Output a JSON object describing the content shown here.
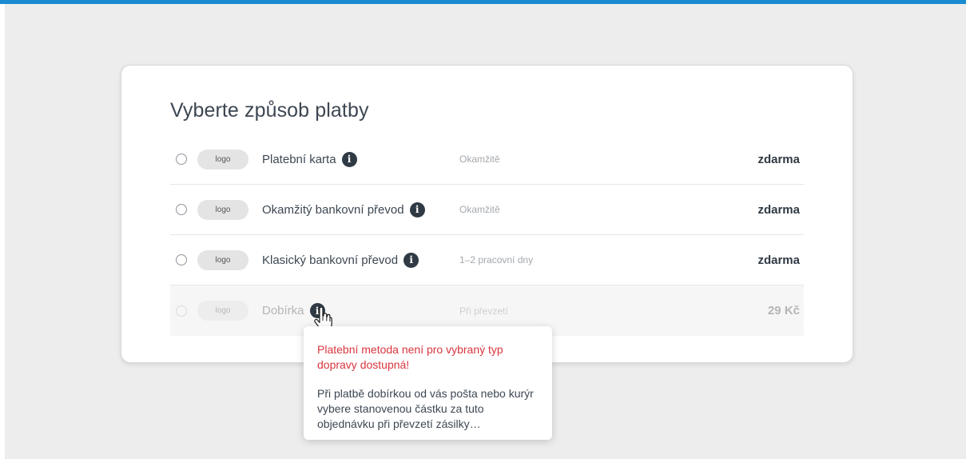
{
  "page": {
    "title": "Vyberte způsob platby",
    "accent_color": "#1a8ad1"
  },
  "methods": [
    {
      "logo": "logo",
      "name": "Platební karta",
      "timing": "Okamžitě",
      "price": "zdarma",
      "disabled": false
    },
    {
      "logo": "logo",
      "name": "Okamžitý bankovní převod",
      "timing": "Okamžitě",
      "price": "zdarma",
      "disabled": false
    },
    {
      "logo": "logo",
      "name": "Klasický bankovní převod",
      "timing": "1–2 pracovní dny",
      "price": "zdarma",
      "disabled": false
    },
    {
      "logo": "logo",
      "name": "Dobírka",
      "timing": "Při převzetí",
      "price": "29 Kč",
      "disabled": true
    }
  ],
  "tooltip": {
    "warning": "Platební metoda není pro vybraný typ dopravy dostupná!",
    "description": "Při platbě dobírkou od vás pošta nebo kurýr vybere stanovenou částku za tuto objednávku při převzetí zásilky…"
  },
  "icons": {
    "info": "info-icon",
    "cursor": "hand-pointer-icon"
  }
}
